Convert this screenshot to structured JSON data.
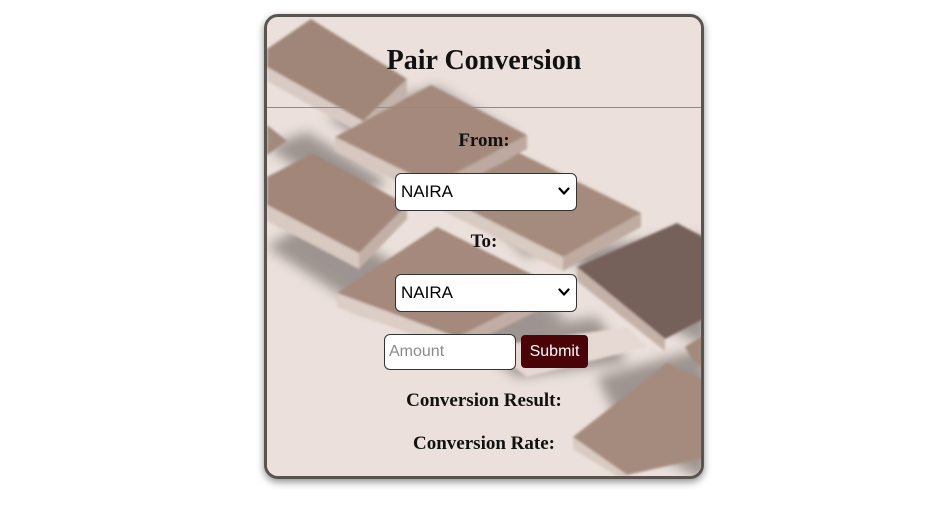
{
  "title": "Pair Conversion",
  "from": {
    "label": "From:",
    "selected": "NAIRA"
  },
  "to": {
    "label": "To:",
    "selected": "NAIRA"
  },
  "amount": {
    "placeholder": "Amount",
    "value": ""
  },
  "submit_label": "Submit",
  "result_label": "Conversion Result:",
  "rate_label": "Conversion Rate:",
  "colors": {
    "submit_bg": "#4a0306",
    "card_bg": "#ebe0db",
    "tile": "#a38a7c"
  }
}
